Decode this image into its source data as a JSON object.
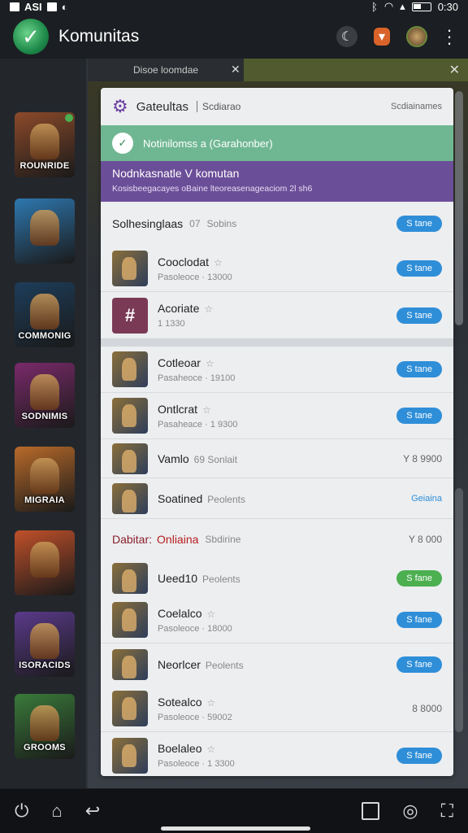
{
  "status": {
    "left_text": "ASI",
    "time": "0:30"
  },
  "app": {
    "title": "Komunitas"
  },
  "rail": {
    "games": [
      {
        "label": "ROUNRIDE",
        "bg": "#8c4a2a"
      },
      {
        "label": "",
        "bg": "#2e78b0"
      },
      {
        "label": "COMMONIG",
        "bg": "#1d3d5a"
      },
      {
        "label": "SODNIMIS",
        "bg": "#7a2a6a"
      },
      {
        "label": "MIGRAIA",
        "bg": "#b86a2a"
      },
      {
        "label": "",
        "bg": "#c0502a"
      },
      {
        "label": "ISORACIDS",
        "bg": "#5a3a8a"
      },
      {
        "label": "GROOMS",
        "bg": "#3a7a3a"
      }
    ]
  },
  "dismiss_bar": {
    "label": "Disoe loomdae"
  },
  "header": {
    "title": "Gateultas",
    "sub": "Scdiarao",
    "right": "Scdiainames"
  },
  "notice": {
    "text": "Notinilomss a (Garahonber)"
  },
  "banner": {
    "title": "Nodnkasnatle V komutan",
    "sub": "Kosisbeegacayes oBaine lteoreasenageaciom 2l sh6"
  },
  "section1": {
    "title": "Solhesinglaas",
    "count": "07",
    "count_label": "Sobins",
    "button": "S tane",
    "rows": [
      {
        "name": "Cooclodat",
        "desc": "Pasoleoce · 13000",
        "button": "S tane",
        "purple": false
      },
      {
        "name": "Acoriate",
        "desc": "1 1330",
        "button": "S tane",
        "purple": true
      }
    ]
  },
  "section2": {
    "rows": [
      {
        "name": "Cotleoar",
        "desc": "Pasaheoce · 19100",
        "button": "S tane"
      },
      {
        "name": "Ontlcrat",
        "desc": "Pasaheace · 1 9300",
        "button": "S tane"
      }
    ]
  },
  "section3": {
    "rows": [
      {
        "name": "Vamlo",
        "tag": "69 Sonlait",
        "value": "Y 8 9900"
      },
      {
        "name": "Soatined",
        "tag": "Peolents",
        "link": "Geiaina"
      }
    ]
  },
  "section4": {
    "title_a": "Dabitar:",
    "title_b": "Onliaina",
    "sub": "Sbdirine",
    "value": "Y 8 000",
    "rows": [
      {
        "name": "Ueed10",
        "tag": "Peolents",
        "button": "S fane",
        "green": true
      },
      {
        "name": "Coelalco",
        "desc": "Pasoleoce · 18000",
        "button": "S fane"
      },
      {
        "name": "Neorlcer",
        "tag": "Peolents",
        "button": "S fane"
      },
      {
        "name": "Sotealco",
        "desc": "Pasoleoce · 59002",
        "value": "8 8000"
      },
      {
        "name": "Boelaleo",
        "desc": "Pasoleoce · 1 3300",
        "button": "S fane"
      }
    ]
  }
}
